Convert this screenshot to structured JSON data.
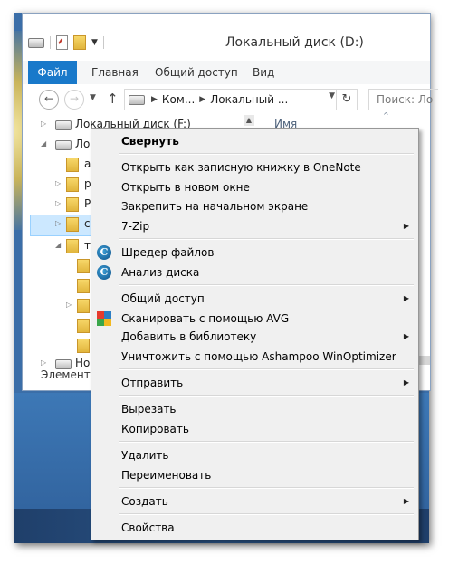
{
  "window": {
    "title": "Локальный диск (D:)"
  },
  "ribbon": {
    "tabs": [
      "Файл",
      "Главная",
      "Общий доступ",
      "Вид"
    ]
  },
  "address": {
    "crumbs": [
      "Ком...",
      "Локальный ..."
    ],
    "search_placeholder": "Поиск: Ло"
  },
  "tree": {
    "items": [
      {
        "label": "Локальный диск (F:)",
        "icon": "drive-icon"
      },
      {
        "label": "Лок",
        "icon": "drive-icon"
      },
      {
        "label": "а",
        "icon": "folder-icon"
      },
      {
        "label": "р",
        "icon": "folder-icon"
      },
      {
        "label": "Р",
        "icon": "folder-icon"
      },
      {
        "label": "с",
        "icon": "folder-icon"
      },
      {
        "label": "те",
        "icon": "folder-icon"
      },
      {
        "label": "",
        "icon": "folder-icon"
      },
      {
        "label": "",
        "icon": "folder-icon"
      },
      {
        "label": "",
        "icon": "folder-icon"
      },
      {
        "label": "",
        "icon": "folder-icon"
      },
      {
        "label": "",
        "icon": "folder-icon"
      },
      {
        "label": "Но",
        "icon": "drive-icon"
      }
    ]
  },
  "content": {
    "column_name": "Имя"
  },
  "status": {
    "text": "Элементо"
  },
  "context_menu": {
    "items": [
      {
        "label": "Свернуть",
        "bold": true
      },
      {
        "label": "Открыть как записную книжку в OneNote"
      },
      {
        "label": "Открыть в новом окне"
      },
      {
        "label": "Закрепить на начальном экране"
      },
      {
        "label": "7-Zip",
        "submenu": true
      },
      {
        "label": "Шредер файлов",
        "icon": "ccleaner-icon"
      },
      {
        "label": "Анализ диска",
        "icon": "ccleaner-icon"
      },
      {
        "label": "Общий доступ",
        "submenu": true
      },
      {
        "label": "Сканировать с помощью AVG",
        "icon": "avg-icon"
      },
      {
        "label": "Добавить в библиотеку",
        "submenu": true
      },
      {
        "label": "Уничтожить с помощью Ashampoo WinOptimizer"
      },
      {
        "label": "Отправить",
        "submenu": true
      },
      {
        "label": "Вырезать"
      },
      {
        "label": "Копировать"
      },
      {
        "label": "Удалить"
      },
      {
        "label": "Переименовать"
      },
      {
        "label": "Создать",
        "submenu": true
      },
      {
        "label": "Свойства"
      }
    ],
    "ccleaner_glyph": "C"
  },
  "colors": {
    "file_tab": "#1979ca",
    "selection": "#cce8ff",
    "menu_bg": "#f0f0f0"
  }
}
